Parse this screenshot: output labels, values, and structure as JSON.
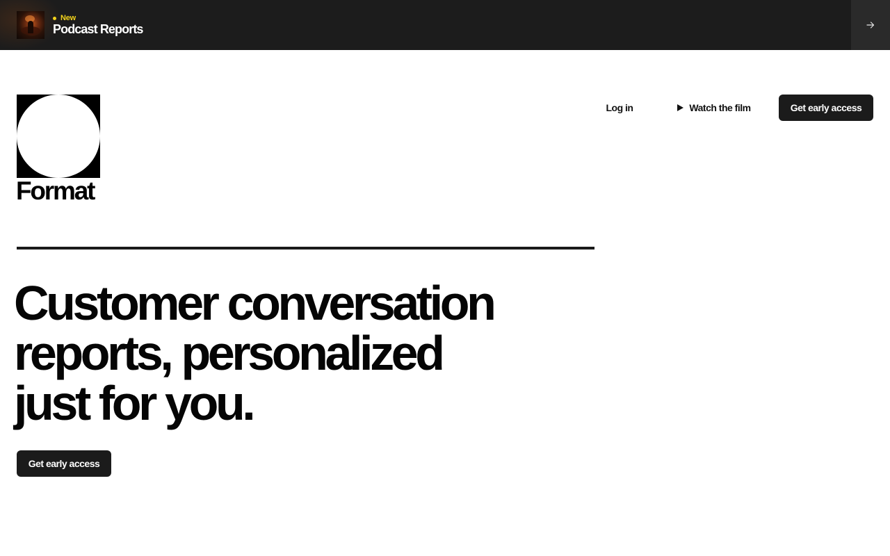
{
  "banner": {
    "tag": "New",
    "title": "Podcast Reports",
    "arrow_icon": "arrow-right-icon",
    "thumbnail_icon": "podcast-thumbnail",
    "tag_color": "#f2d21b",
    "background": "#1c1c1c"
  },
  "brand": {
    "name": "Format",
    "logo_icon": "format-logo-mark"
  },
  "nav": {
    "login": "Log in",
    "watch_film": "Watch the film",
    "watch_film_icon": "play-icon",
    "cta": "Get early access"
  },
  "hero": {
    "headline_lines": [
      "Customer conversation",
      "reports, personalized",
      "just for you."
    ],
    "cta": "Get early access"
  },
  "colors": {
    "button_bg": "#1b1b1b",
    "text": "#0a0a0a",
    "page_bg": "#ffffff"
  }
}
